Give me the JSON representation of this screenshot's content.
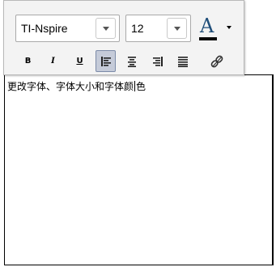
{
  "toolbar": {
    "font_family": "TI-Nspire",
    "font_size": "12",
    "bold_label": "B",
    "italic_label": "I",
    "underline_label": "U",
    "color_letter": "A",
    "color_underline": "#0a0a0a",
    "active_alignment": "left"
  },
  "editor": {
    "text": "更改字体、字体大小和字体颜",
    "text_after_caret": "色"
  }
}
